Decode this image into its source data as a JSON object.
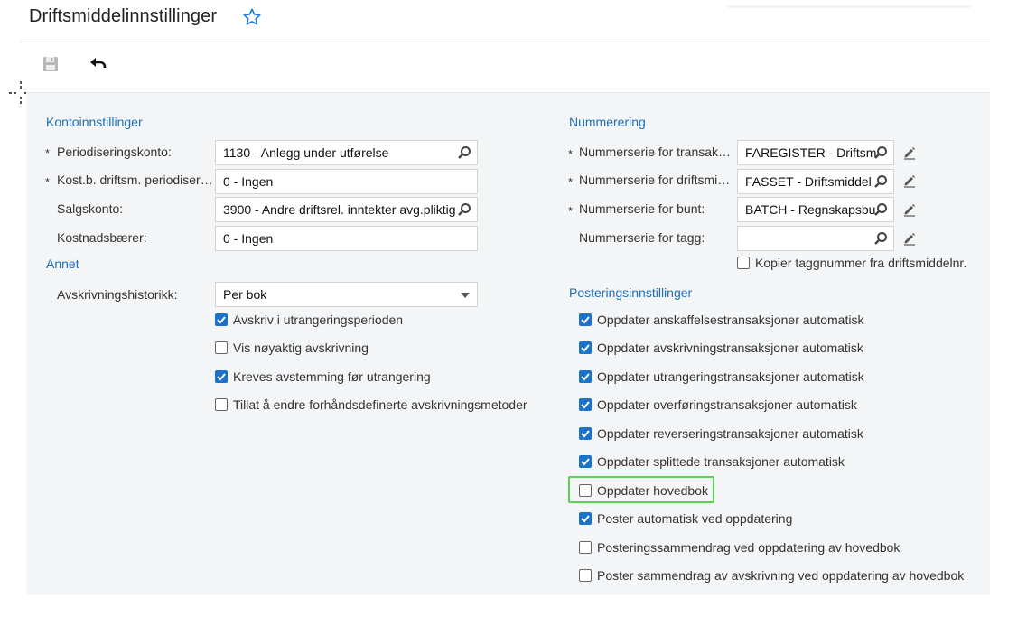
{
  "page": {
    "title": "Driftsmiddelinnstillinger"
  },
  "toolbar": {
    "save_icon": "save-icon",
    "undo_icon": "undo-icon",
    "favorite_icon": "star-icon"
  },
  "colors": {
    "accent": "#1a73c9",
    "section": "#1d6fb8",
    "highlight": "#5fcf5a",
    "form_bg": "#f4f5f6"
  },
  "left": {
    "kontoinnstillinger": {
      "title": "Kontoinnstillinger",
      "fields": [
        {
          "label": "Periodiseringskonto:",
          "required": "*",
          "value": "1130 - Anlegg under utførelse"
        },
        {
          "label": "Kost.b. driftsm. periodiser…",
          "required": "*",
          "value": "0 - Ingen"
        },
        {
          "label": "Salgskonto:",
          "required": "",
          "value": "3900 - Andre driftsrel. inntekter avg.pliktig"
        },
        {
          "label": "Kostnadsbærer:",
          "required": "",
          "value": "0 - Ingen"
        }
      ]
    },
    "annet": {
      "title": "Annet",
      "history_label": "Avskrivningshistorikk:",
      "history_value": "Per bok",
      "checkboxes": [
        {
          "label": "Avskriv i utrangeringsperioden",
          "checked": true
        },
        {
          "label": "Vis nøyaktig avskrivning",
          "checked": false
        },
        {
          "label": "Kreves avstemming før utrangering",
          "checked": true
        },
        {
          "label": "Tillat å endre forhåndsdefinerte avskrivningsmetoder",
          "checked": false
        }
      ]
    }
  },
  "right": {
    "nummerering": {
      "title": "Nummerering",
      "fields": [
        {
          "label": "Nummerserie for transak…",
          "required": "*",
          "value": "FAREGISTER - Driftsm"
        },
        {
          "label": "Nummerserie for driftsmi…",
          "required": "*",
          "value": "FASSET - Driftsmiddel"
        },
        {
          "label": "Nummerserie for bunt:",
          "required": "*",
          "value": "BATCH - Regnskapsbu"
        },
        {
          "label": "Nummerserie for tagg:",
          "required": "",
          "value": ""
        }
      ],
      "copy_tag": {
        "label": "Kopier taggnummer fra driftsmiddelnr.",
        "checked": false
      }
    },
    "posteringsinnstillinger": {
      "title": "Posteringsinnstillinger",
      "checkboxes": [
        {
          "label": "Oppdater anskaffelsestransaksjoner automatisk",
          "checked": true
        },
        {
          "label": "Oppdater avskrivningstransaksjoner automatisk",
          "checked": true
        },
        {
          "label": "Oppdater utrangeringstransaksjoner automatisk",
          "checked": true
        },
        {
          "label": "Oppdater overføringstransaksjoner automatisk",
          "checked": true
        },
        {
          "label": "Oppdater reverseringstransaksjoner automatisk",
          "checked": true
        },
        {
          "label": "Oppdater splittede transaksjoner automatisk",
          "checked": true
        },
        {
          "label": "Oppdater hovedbok",
          "checked": false
        },
        {
          "label": "Poster automatisk ved oppdatering",
          "checked": true
        },
        {
          "label": "Posteringssammendrag ved oppdatering av hovedbok",
          "checked": false
        },
        {
          "label": "Poster sammendrag av avskrivning ved oppdatering av hovedbok",
          "checked": false
        }
      ]
    }
  }
}
